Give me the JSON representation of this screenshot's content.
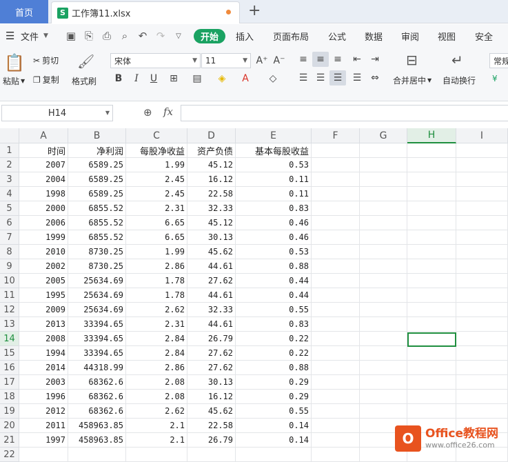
{
  "tabs": {
    "home": "首页",
    "file": "工作簿11.xlsx"
  },
  "menu": {
    "file": "文件",
    "start": "开始",
    "items": [
      "插入",
      "页面布局",
      "公式",
      "数据",
      "审阅",
      "视图",
      "安全"
    ]
  },
  "ribbon": {
    "paste": "粘贴",
    "cut": "剪切",
    "copy": "复制",
    "format_painter": "格式刷",
    "font": "宋体",
    "size": "11",
    "merge": "合并居中",
    "wrap": "自动换行",
    "number_format": "常规",
    "bold": "B",
    "italic": "I",
    "underline": "U"
  },
  "formula": {
    "namebox": "H14",
    "fx": "fx",
    "value": ""
  },
  "columns": [
    "A",
    "B",
    "C",
    "D",
    "E",
    "F",
    "G",
    "H",
    "I"
  ],
  "header_row": [
    "时间",
    "净利润",
    "每股净收益",
    "资产负债",
    "基本每股收益"
  ],
  "rows": [
    [
      "2007",
      "6589.25",
      "1.99",
      "45.12",
      "0.53"
    ],
    [
      "2004",
      "6589.25",
      "2.45",
      "16.12",
      "0.11"
    ],
    [
      "1998",
      "6589.25",
      "2.45",
      "22.58",
      "0.11"
    ],
    [
      "2000",
      "6855.52",
      "2.31",
      "32.33",
      "0.83"
    ],
    [
      "2006",
      "6855.52",
      "6.65",
      "45.12",
      "0.46"
    ],
    [
      "1999",
      "6855.52",
      "6.65",
      "30.13",
      "0.46"
    ],
    [
      "2010",
      "8730.25",
      "1.99",
      "45.62",
      "0.53"
    ],
    [
      "2002",
      "8730.25",
      "2.86",
      "44.61",
      "0.88"
    ],
    [
      "2005",
      "25634.69",
      "1.78",
      "27.62",
      "0.44"
    ],
    [
      "1995",
      "25634.69",
      "1.78",
      "44.61",
      "0.44"
    ],
    [
      "2009",
      "25634.69",
      "2.62",
      "32.33",
      "0.55"
    ],
    [
      "2013",
      "33394.65",
      "2.31",
      "44.61",
      "0.83"
    ],
    [
      "2008",
      "33394.65",
      "2.84",
      "26.79",
      "0.22"
    ],
    [
      "1994",
      "33394.65",
      "2.84",
      "27.62",
      "0.22"
    ],
    [
      "2014",
      "44318.99",
      "2.86",
      "27.62",
      "0.88"
    ],
    [
      "2003",
      "68362.6",
      "2.08",
      "30.13",
      "0.29"
    ],
    [
      "1996",
      "68362.6",
      "2.08",
      "16.12",
      "0.29"
    ],
    [
      "2012",
      "68362.6",
      "2.62",
      "45.62",
      "0.55"
    ],
    [
      "2011",
      "458963.85",
      "2.1",
      "22.58",
      "0.14"
    ],
    [
      "1997",
      "458963.85",
      "2.1",
      "26.79",
      "0.14"
    ]
  ],
  "watermark": {
    "name": "Office教程网",
    "url": "www.office26.com"
  }
}
